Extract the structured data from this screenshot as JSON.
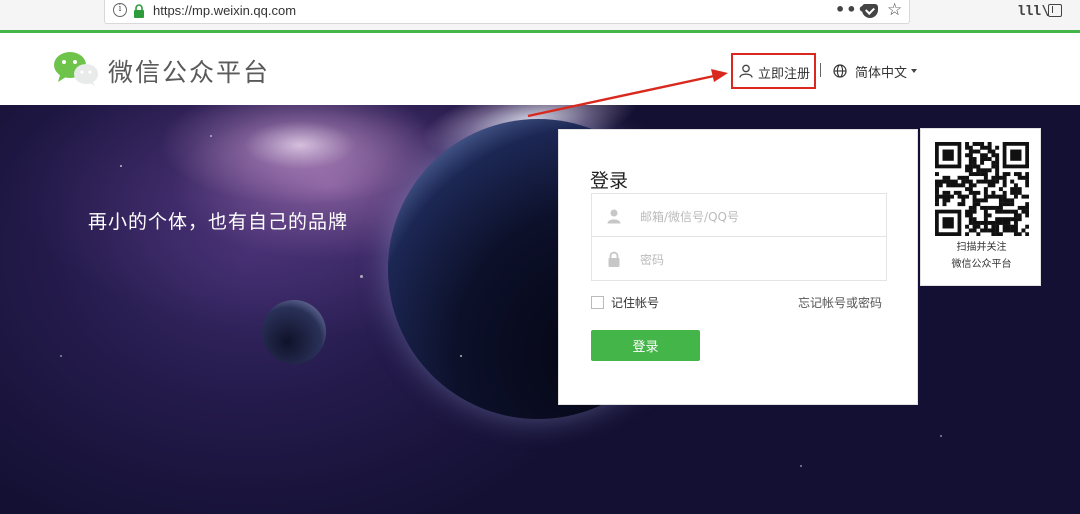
{
  "browser": {
    "url": "https://mp.weixin.qq.com",
    "more_label": "•••",
    "star_label": "☆",
    "library_label": "lll\\"
  },
  "header": {
    "site_title": "微信公众平台",
    "register_label": "立即注册",
    "language_label": "简体中文"
  },
  "hero": {
    "slogan": "再小的个体，也有自己的品牌"
  },
  "login": {
    "title": "登录",
    "account_placeholder": "邮箱/微信号/QQ号",
    "password_placeholder": "密码",
    "remember_label": "记住帐号",
    "forgot_label": "忘记帐号或密码",
    "submit_label": "登录"
  },
  "qr": {
    "caption_line1": "扫描并关注",
    "caption_line2": "微信公众平台"
  },
  "colors": {
    "brand_green": "#44b549",
    "annotation_red": "#d9281e"
  },
  "icons": [
    "info-icon",
    "lock-icon",
    "pocket-icon",
    "bookmark-star-icon",
    "library-icon",
    "sidebar-icon",
    "wechat-logo-icon",
    "user-icon",
    "globe-icon",
    "caret-down-icon",
    "password-lock-icon",
    "qr-code"
  ]
}
